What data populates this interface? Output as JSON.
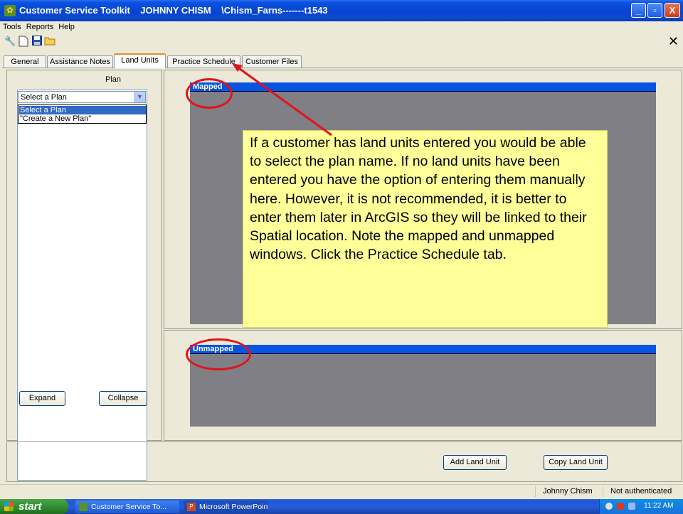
{
  "window": {
    "title": "Customer Service Toolkit    JOHNNY CHISM    \\Chism_Farns-------t1543",
    "minimize": "_",
    "restore": "▫",
    "close": "X"
  },
  "menu": [
    "Tools",
    "Reports",
    "Help"
  ],
  "toolbar": {
    "close_glyph": "✕"
  },
  "tabs": [
    "General",
    "Assistance Notes",
    "Land Units",
    "Practice Schedule",
    "Customer Files"
  ],
  "active_tab": "Land Units",
  "plan_panel": {
    "label": "Plan",
    "selected": "Select a Plan",
    "options": [
      "Select a Plan",
      "\"Create a New Plan\""
    ],
    "expand_button": "Expand",
    "collapse_button": "Collapse"
  },
  "mapped_section": {
    "title": "Mapped"
  },
  "unmapped_section": {
    "title": "Unmapped"
  },
  "callout": {
    "text": "If a customer has land units entered you would be able to select the plan name. If no land units have been entered you have the option of entering them manually here. However, it is not recommended, it is better to enter them later in ArcGIS so they will be linked to their Spatial location. Note the mapped and unmapped windows. Click the Practice Schedule tab."
  },
  "actions": {
    "add_land_unit": "Add Land Unit",
    "copy_land_unit": "Copy Land Unit"
  },
  "status": {
    "user": "Johnny Chism",
    "auth": "Not authenticated"
  },
  "taskbar": {
    "start": "start",
    "items": [
      "Customer Service To...",
      "Microsoft PowerPoint ..."
    ],
    "clock": "11:22 AM"
  },
  "colors": {
    "header_blue": "#0654e0",
    "callout_bg": "#ffff99",
    "annotation_red": "#e1131a"
  }
}
